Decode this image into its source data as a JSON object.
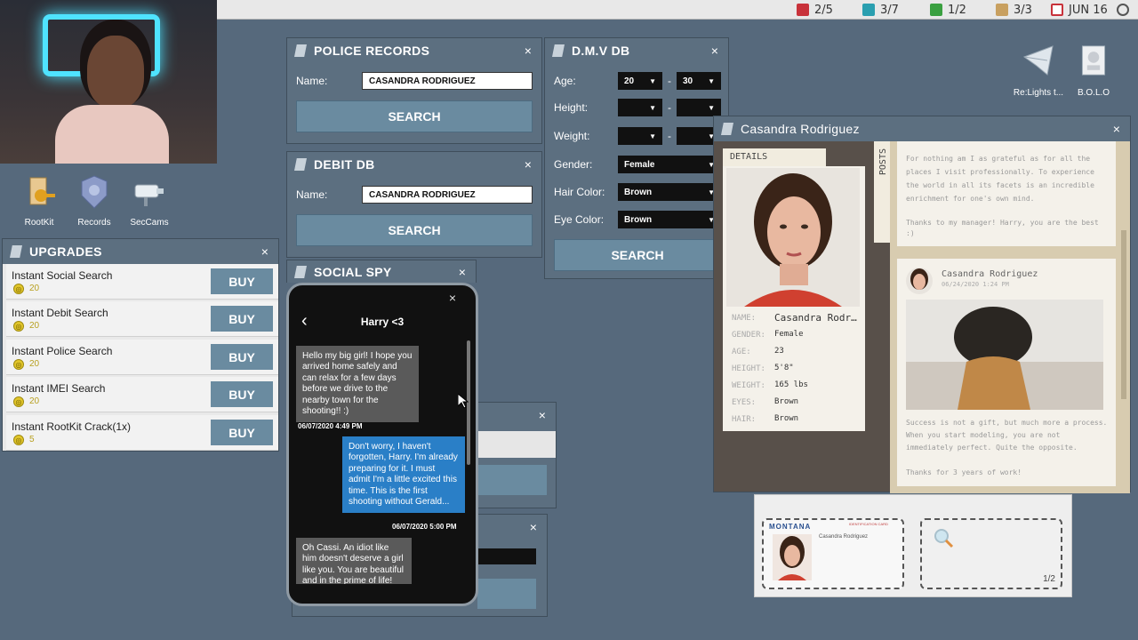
{
  "topbar": {
    "stats": [
      {
        "icon": "red-card-icon",
        "text": "2/5",
        "color": "#c8323a"
      },
      {
        "icon": "teal-note-icon",
        "text": "3/7",
        "color": "#2a9fb0"
      },
      {
        "icon": "green-file-icon",
        "text": "1/2",
        "color": "#3aa040"
      },
      {
        "icon": "tan-scroll-icon",
        "text": "3/3",
        "color": "#c8a060"
      },
      {
        "icon": "calendar-icon",
        "text": "JUN 16",
        "color": "#c8323a"
      }
    ]
  },
  "desktop": {
    "icons": [
      {
        "label": "RootKit"
      },
      {
        "label": "Records"
      },
      {
        "label": "SecCams"
      }
    ],
    "right_icons": [
      {
        "label": "Re:Lights t..."
      },
      {
        "label": "B.O.L.O"
      }
    ]
  },
  "upgrades": {
    "title": "UPGRADES",
    "close": "×",
    "items": [
      {
        "name": "Instant Social Search",
        "price": "20",
        "buy": "BUY"
      },
      {
        "name": "Instant Debit Search",
        "price": "20",
        "buy": "BUY"
      },
      {
        "name": "Instant Police Search",
        "price": "20",
        "buy": "BUY"
      },
      {
        "name": "Instant IMEI Search",
        "price": "20",
        "buy": "BUY"
      },
      {
        "name": "Instant RootKit Crack(1x)",
        "price": "5",
        "buy": "BUY"
      }
    ]
  },
  "police": {
    "title": "POLICE RECORDS",
    "name_label": "Name:",
    "name_value": "CASANDRA RODRIGUEZ",
    "search": "SEARCH",
    "close": "×"
  },
  "debit": {
    "title": "DEBIT DB",
    "name_label": "Name:",
    "name_value": "CASANDRA RODRIGUEZ",
    "search": "SEARCH",
    "close": "×"
  },
  "dmv": {
    "title": "D.M.V DB",
    "close": "×",
    "age_label": "Age:",
    "age_min": "20",
    "age_max": "30",
    "dash": "-",
    "height_label": "Height:",
    "weight_label": "Weight:",
    "gender_label": "Gender:",
    "gender_value": "Female",
    "hair_label": "Hair Color:",
    "hair_value": "Brown",
    "eye_label": "Eye Color:",
    "eye_value": "Brown",
    "search": "SEARCH"
  },
  "social": {
    "title": "SOCIAL SPY",
    "close": "×",
    "phone": {
      "close": "×",
      "back": "‹",
      "contact": "Harry <3",
      "messages": [
        {
          "dir": "in",
          "text": "Hello my big girl! I hope you arrived home safely and can relax for a few days before we drive to the nearby town for the shooting!! :)",
          "time": "06/07/2020 4:49 PM"
        },
        {
          "dir": "out",
          "text": "Don't worry, I haven't forgotten, Harry. I'm already preparing for it. I must admit I'm a little excited this time. This is the first shooting without Gerald...",
          "time": "06/07/2020 5:00 PM"
        },
        {
          "dir": "in",
          "text": "Oh Cassi. An idiot like him doesn't deserve a girl like you. You are beautiful and in the prime of life! Don't let",
          "time": ""
        }
      ]
    }
  },
  "profile": {
    "title": "Casandra Rodriguez",
    "close": "×",
    "details_tab": "DETAILS",
    "posts_tab": "POSTS",
    "fields": [
      {
        "label": "NAME:",
        "value": "Casandra Rodr…"
      },
      {
        "label": "GENDER:",
        "value": "Female"
      },
      {
        "label": "AGE:",
        "value": "23"
      },
      {
        "label": "HEIGHT:",
        "value": "5'8\""
      },
      {
        "label": "WEIGHT:",
        "value": "165 lbs"
      },
      {
        "label": "EYES:",
        "value": "Brown"
      },
      {
        "label": "HAIR:",
        "value": "Brown"
      }
    ],
    "post1": {
      "text": "For nothing am I as grateful as for all the places I visit professionally. To experience the world in all its facets is an incredible enrichment for one's own mind.",
      "thanks": "Thanks to my manager! Harry, you are the best :)"
    },
    "post2": {
      "author": "Casandra Rodriguez",
      "date": "06/24/2020 1:24 PM",
      "text": "Success is not a gift, but much more a process. When you start modeling, you are not immediately perfect. Quite the opposite.",
      "thanks": "Thanks for 3 years of work!"
    }
  },
  "idcard": {
    "state": "MONTANA",
    "cert": "IDENTIFICATION CARD",
    "name": "Casandra Rodriguez",
    "pager": "1/2"
  }
}
